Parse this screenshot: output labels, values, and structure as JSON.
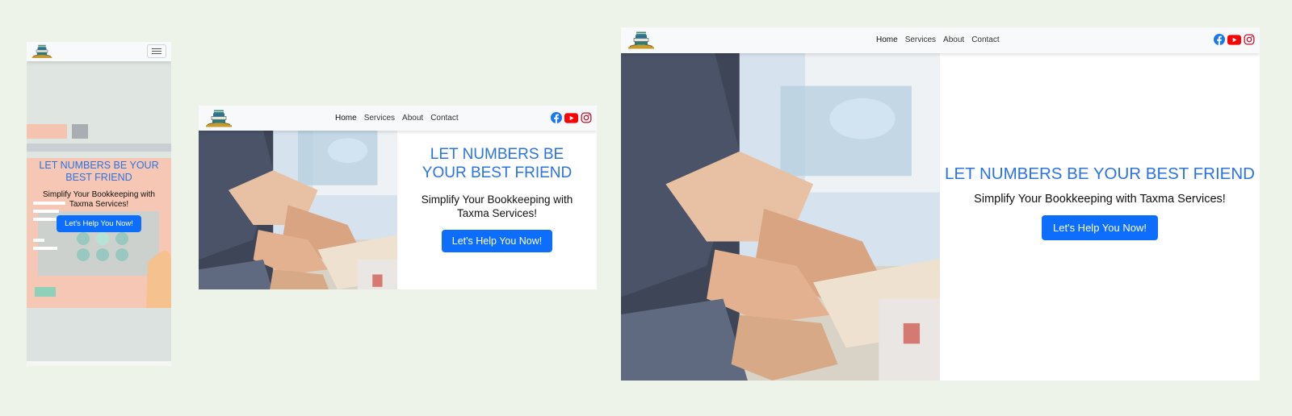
{
  "brand": {
    "logo_icon": "books-stack-logo-icon"
  },
  "nav": {
    "links": [
      {
        "label": "Home",
        "active": true
      },
      {
        "label": "Services",
        "active": false
      },
      {
        "label": "About",
        "active": false
      },
      {
        "label": "Contact",
        "active": false
      }
    ],
    "socials": [
      "facebook-icon",
      "youtube-icon",
      "instagram-icon"
    ],
    "menu_icon": "hamburger-menu-icon"
  },
  "hero": {
    "title": "LET NUMBERS BE YOUR BEST FRIEND",
    "subtitle": "Simplify Your Bookkeeping with Taxma Services!",
    "cta_label": "Let's Help You Now!"
  },
  "colors": {
    "page_bg": "#eef3ea",
    "navbar_bg": "#f8f9fa",
    "title_blue": "#2a73e0",
    "button_blue": "#0d6efd",
    "facebook_blue": "#1877f2",
    "youtube_red": "#ff0000",
    "instagram_red": "#c13584"
  },
  "previews": [
    "mobile",
    "tablet",
    "desktop"
  ]
}
